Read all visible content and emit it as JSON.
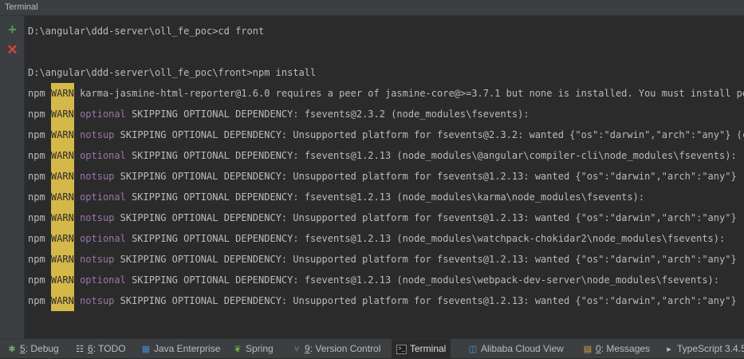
{
  "window": {
    "title": "Terminal"
  },
  "toolbar": {
    "add_icon": "plus-icon",
    "close_icon": "close-icon"
  },
  "terminal": {
    "lines": [
      {
        "type": "cmd",
        "text": "D:\\angular\\ddd-server\\oll_fe_poc>cd front"
      },
      {
        "type": "blank",
        "text": ""
      },
      {
        "type": "cmd",
        "text": "D:\\angular\\ddd-server\\oll_fe_poc\\front>npm install"
      },
      {
        "type": "warn",
        "prefix": "npm",
        "badge": "WARN",
        "code": "",
        "text": "karma-jasmine-html-reporter@1.6.0 requires a peer of jasmine-core@>=3.7.1 but none is installed. You must install peer"
      },
      {
        "type": "warn",
        "prefix": "npm",
        "badge": "WARN",
        "code": "optional",
        "text": " SKIPPING OPTIONAL DEPENDENCY: fsevents@2.3.2 (node_modules\\fsevents):"
      },
      {
        "type": "warn",
        "prefix": "npm",
        "badge": "WARN",
        "code": "notsup",
        "text": " SKIPPING OPTIONAL DEPENDENCY: Unsupported platform for fsevents@2.3.2: wanted {\"os\":\"darwin\",\"arch\":\"any\"} (curr"
      },
      {
        "type": "warn",
        "prefix": "npm",
        "badge": "WARN",
        "code": "optional",
        "text": " SKIPPING OPTIONAL DEPENDENCY: fsevents@1.2.13 (node_modules\\@angular\\compiler-cli\\node_modules\\fsevents):"
      },
      {
        "type": "warn",
        "prefix": "npm",
        "badge": "WARN",
        "code": "notsup",
        "text": " SKIPPING OPTIONAL DEPENDENCY: Unsupported platform for fsevents@1.2.13: wanted {\"os\":\"darwin\",\"arch\":\"any\"} (curr"
      },
      {
        "type": "warn",
        "prefix": "npm",
        "badge": "WARN",
        "code": "optional",
        "text": " SKIPPING OPTIONAL DEPENDENCY: fsevents@1.2.13 (node_modules\\karma\\node_modules\\fsevents):"
      },
      {
        "type": "warn",
        "prefix": "npm",
        "badge": "WARN",
        "code": "notsup",
        "text": " SKIPPING OPTIONAL DEPENDENCY: Unsupported platform for fsevents@1.2.13: wanted {\"os\":\"darwin\",\"arch\":\"any\"} (curr"
      },
      {
        "type": "warn",
        "prefix": "npm",
        "badge": "WARN",
        "code": "optional",
        "text": " SKIPPING OPTIONAL DEPENDENCY: fsevents@1.2.13 (node_modules\\watchpack-chokidar2\\node_modules\\fsevents):"
      },
      {
        "type": "warn",
        "prefix": "npm",
        "badge": "WARN",
        "code": "notsup",
        "text": " SKIPPING OPTIONAL DEPENDENCY: Unsupported platform for fsevents@1.2.13: wanted {\"os\":\"darwin\",\"arch\":\"any\"} (curr"
      },
      {
        "type": "warn",
        "prefix": "npm",
        "badge": "WARN",
        "code": "optional",
        "text": " SKIPPING OPTIONAL DEPENDENCY: fsevents@1.2.13 (node_modules\\webpack-dev-server\\node_modules\\fsevents):"
      },
      {
        "type": "warn",
        "prefix": "npm",
        "badge": "WARN",
        "code": "notsup",
        "text": " SKIPPING OPTIONAL DEPENDENCY: Unsupported platform for fsevents@1.2.13: wanted {\"os\":\"darwin\",\"arch\":\"any\"} (curr"
      }
    ]
  },
  "bottom_tabs": {
    "debug": {
      "num": "5",
      "label": ": Debug",
      "icon": "bug-icon"
    },
    "todo": {
      "num": "6",
      "label": ": TODO",
      "icon": "todo-icon"
    },
    "java": {
      "label": "Java Enterprise",
      "icon": "java-enterprise-icon"
    },
    "spring": {
      "label": "Spring",
      "icon": "spring-leaf-icon"
    },
    "vcs": {
      "num": "9",
      "label": ": Version Control",
      "icon": "version-control-icon"
    },
    "terminal": {
      "label": "Terminal",
      "icon": "terminal-icon"
    },
    "alibaba": {
      "label": "Alibaba Cloud View",
      "icon": "alibaba-cloud-icon"
    },
    "messages": {
      "num": "0",
      "label": ": Messages",
      "icon": "messages-icon"
    },
    "typescript": {
      "label": "TypeScript 3.4.5",
      "icon": "typescript-icon"
    }
  },
  "colors": {
    "warn_bg": "#d4b84a",
    "code": "#9876aa",
    "text": "#bbbbbb",
    "bg": "#2b2b2b"
  }
}
